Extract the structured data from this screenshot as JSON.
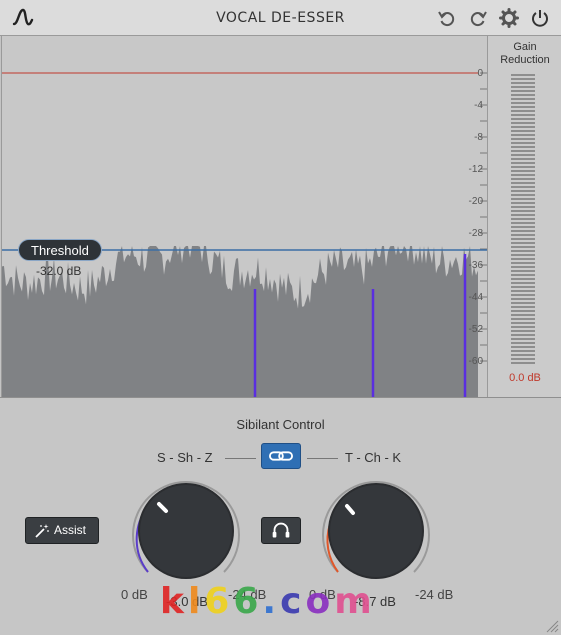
{
  "app": {
    "title": "VOCAL DE-ESSER"
  },
  "icons": {
    "logo": "waveform-logo-icon",
    "undo": "undo-icon",
    "redo": "redo-icon",
    "settings": "gear-icon",
    "power": "power-icon",
    "link": "link-icon",
    "wand": "magic-wand-icon",
    "headphones": "headphones-icon"
  },
  "scale": {
    "labels": [
      "0",
      "-4",
      "-8",
      "-12",
      "-20",
      "-28",
      "-36",
      "-44",
      "-52",
      "-60"
    ]
  },
  "threshold": {
    "label": "Threshold",
    "value": "-32.0 dB"
  },
  "gain_reduction": {
    "title_line1": "Gain",
    "title_line2": "Reduction",
    "value": "0.0 dB"
  },
  "sibilant": {
    "title": "Sibilant Control",
    "left_band": "S - Sh - Z",
    "right_band": "T - Ch - K",
    "assist_label": "Assist",
    "left_knob": {
      "min": "0 dB",
      "max": "-24 dB",
      "value": "-3.0 dB"
    },
    "right_knob": {
      "min": "0 dB",
      "max": "-24 dB",
      "value": "-8.7 dB"
    }
  },
  "watermark": {
    "chars": [
      "k",
      "l",
      "6",
      "6",
      ".",
      "c",
      "o",
      "m"
    ]
  },
  "colors": {
    "accent_blue": "#2f6fb4",
    "threshold_line": "#3a6ea5",
    "ceiling_line": "#c0392b",
    "transient": "#5a2ee0",
    "knob_arc_left": "#5a3cc8",
    "knob_arc_right": "#e0572a",
    "meter_value": "#c0392b"
  }
}
